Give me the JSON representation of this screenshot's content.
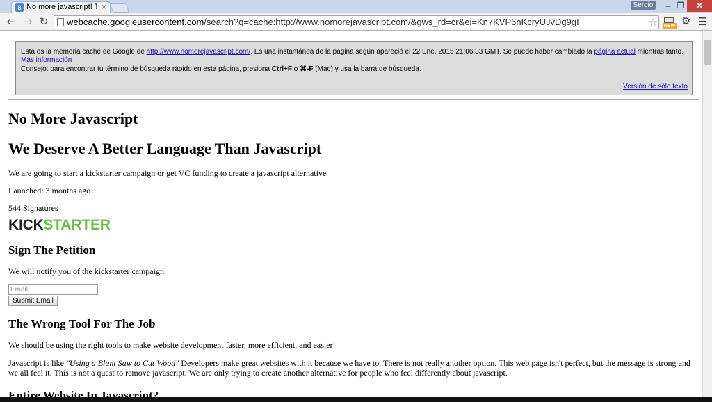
{
  "browser": {
    "tab_title": "No more javascript! This p",
    "tab_close": "×",
    "favicon_letter": "8",
    "profile_name": "Sergio",
    "win_min": "–",
    "win_max": "❐",
    "win_close": "✕",
    "url_host": "webcache.googleusercontent.com",
    "url_path": "/search?q=cache:http://www.nomorejavascript.com/&gws_rd=cr&ei=Kn7KVP6nKcryUJvDg9gI",
    "extension_badge": "NEW",
    "icons": [
      "back-arrow-icon",
      "forward-arrow-icon",
      "reload-icon",
      "page-icon",
      "star-icon",
      "screen-capture-icon",
      "gear-icon",
      "menu-icon"
    ]
  },
  "cache_banner": {
    "line1_prefix": "Esta es la memoria caché de Google de ",
    "cached_url": "http://www.nomorejavascript.com/",
    "line1_middle": ". Es una instantánea de la página según apareció el 22 Ene. 2015 21:06:33 GMT. Se puede haber cambiado la ",
    "current_page_link": "página actual",
    "line1_suffix": " mientras tanto. ",
    "more_info_link": "Más información",
    "tip_prefix": "Consejo: para encontrar tu término de búsqueda rápido en esta página, presiona ",
    "tip_key1": "Ctrl+F",
    "tip_or": " o ",
    "tip_key2": "⌘-F",
    "tip_suffix": " (Mac) y usa la barra de búsqueda.",
    "text_only_link": "Versión de sólo texto"
  },
  "page": {
    "title": "No More Javascript",
    "subtitle": "We Deserve A Better Language Than Javascript",
    "intro": "We are going to start a kickstarter campaign or get VC funding to create a javascript alternative",
    "launched": "Launched: 3 months ago",
    "signatures": "544 Signatures",
    "logo_kick": "KICK",
    "logo_starter": "STARTER",
    "petition_heading": "Sign The Petition",
    "notify_text": "We will notify you of the kickstarter campaign.",
    "email_placeholder": "Email",
    "submit_label": "Submit Email",
    "wrong_tool_heading": "The Wrong Tool For The Job",
    "right_tools_text": "We should be using the right tools to make website development faster, more efficient, and easier!",
    "js_like_prefix": "Javascript is like ",
    "js_like_quote": "\"Using a Blunt Saw to Cut Wood\"",
    "js_like_suffix": " Developers make great websites with it because we have to. There is not really another option. This web page isn't perfect, but the message is strong and we all feel it. This is not a quest to remove javascript. We are only trying to create another alternative for people who feel differently about javascript.",
    "cut_off_heading": "Entire Website In Javascript?"
  },
  "colors": {
    "kickstarter_green": "#6cbf4b",
    "link_blue": "#1a0dab",
    "close_red": "#c7423a"
  }
}
